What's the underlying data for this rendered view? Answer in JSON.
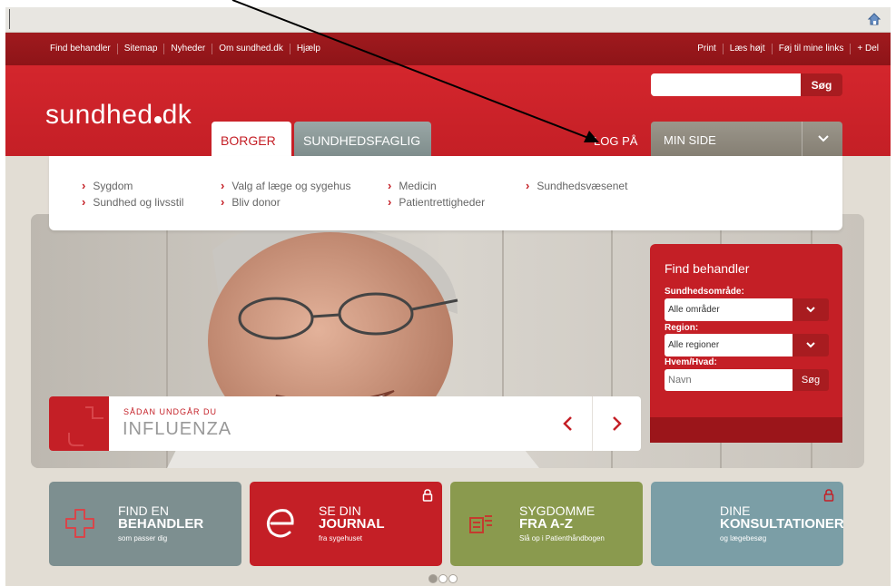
{
  "browser": {
    "home_icon": "home-icon"
  },
  "topbar": {
    "left_links": [
      "Find behandler",
      "Sitemap",
      "Nyheder",
      "Om sundhed.dk",
      "Hjælp"
    ],
    "right_links": [
      "Print",
      "Læs højt",
      "Føj til mine links",
      "+ Del"
    ]
  },
  "header": {
    "logo": "sundhed.dk",
    "logo_left": "sundhed",
    "logo_right": "dk",
    "search_placeholder": "",
    "search_button": "Søg",
    "tab_borger": "BORGER",
    "tab_faglig": "SUNDHEDSFAGLIG",
    "login": "LOG PÅ",
    "minside": "MIN SIDE"
  },
  "subnav": {
    "col1": [
      "Sygdom",
      "Sundhed og livsstil"
    ],
    "col2": [
      "Valg af læge og sygehus",
      "Bliv donor"
    ],
    "col3": [
      "Medicin",
      "Patientrettigheder"
    ],
    "col4": [
      "Sundhedsvæsenet"
    ]
  },
  "banner": {
    "kicker": "SÅDAN UNDGÅR DU",
    "title": "INFLUENZA"
  },
  "finder": {
    "title": "Find behandler",
    "area_label": "Sundhedsområde:",
    "area_value": "Alle områder",
    "region_label": "Region:",
    "region_value": "Alle regioner",
    "who_label": "Hvem/Hvad:",
    "name_placeholder": "Navn",
    "search_button": "Søg"
  },
  "tiles": [
    {
      "l1": "FIND EN",
      "l2": "BEHANDLER",
      "l3": "som passer dig",
      "color": "#7d8f90",
      "icon": "cross-outline-icon"
    },
    {
      "l1": "SE DIN",
      "l2": "JOURNAL",
      "l3": "fra sygehuset",
      "color": "#c41f26",
      "icon": "e-journal-icon"
    },
    {
      "l1": "SYGDOMME",
      "l2": "FRA A-Z",
      "l3": "Slå op i Patienthåndbogen",
      "color": "#8a9a4e",
      "icon": "book-icon"
    },
    {
      "l1": "DINE",
      "l2": "KONSULTATIONER",
      "l3": "og lægebesøg",
      "color": "#7b9ea6",
      "icon": ""
    }
  ],
  "carousel": {
    "count": 3,
    "active": 1
  }
}
